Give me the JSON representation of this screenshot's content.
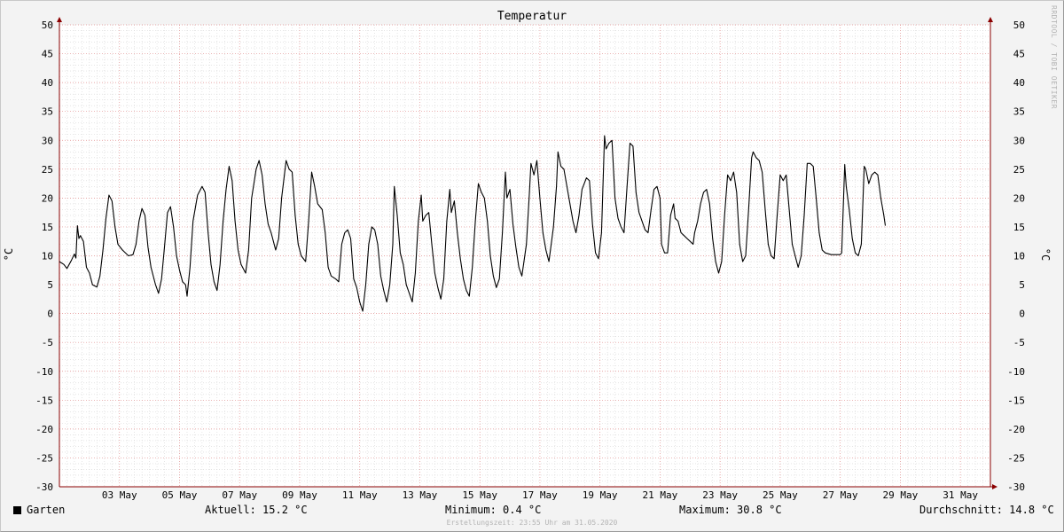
{
  "chart_data": {
    "type": "line",
    "title": "Temperatur",
    "ylabel": "°C",
    "ylim": [
      -30,
      50
    ],
    "yticks": [
      50,
      45,
      40,
      35,
      30,
      25,
      20,
      15,
      10,
      5,
      0,
      -5,
      -10,
      -15,
      -20,
      -25,
      -30
    ],
    "xlim_days": [
      1,
      32
    ],
    "xticks": [
      {
        "day": 3,
        "label": "03 May"
      },
      {
        "day": 5,
        "label": "05 May"
      },
      {
        "day": 7,
        "label": "07 May"
      },
      {
        "day": 9,
        "label": "09 May"
      },
      {
        "day": 11,
        "label": "11 May"
      },
      {
        "day": 13,
        "label": "13 May"
      },
      {
        "day": 15,
        "label": "15 May"
      },
      {
        "day": 17,
        "label": "17 May"
      },
      {
        "day": 19,
        "label": "19 May"
      },
      {
        "day": 21,
        "label": "21 May"
      },
      {
        "day": 23,
        "label": "23 May"
      },
      {
        "day": 25,
        "label": "25 May"
      },
      {
        "day": 27,
        "label": "27 May"
      },
      {
        "day": 29,
        "label": "29 May"
      },
      {
        "day": 31,
        "label": "31 May"
      }
    ],
    "grid": true,
    "series": [
      {
        "name": "Garten",
        "color": "#000000",
        "points": [
          [
            1.0,
            9.0
          ],
          [
            1.15,
            8.5
          ],
          [
            1.25,
            7.8
          ],
          [
            1.4,
            9.2
          ],
          [
            1.5,
            10.3
          ],
          [
            1.55,
            9.6
          ],
          [
            1.6,
            15.2
          ],
          [
            1.65,
            13.0
          ],
          [
            1.7,
            13.5
          ],
          [
            1.8,
            12.5
          ],
          [
            1.9,
            8.0
          ],
          [
            2.0,
            7.0
          ],
          [
            2.1,
            5.0
          ],
          [
            2.25,
            4.6
          ],
          [
            2.35,
            6.5
          ],
          [
            2.45,
            11.0
          ],
          [
            2.55,
            16.5
          ],
          [
            2.65,
            20.5
          ],
          [
            2.75,
            19.5
          ],
          [
            2.85,
            15.0
          ],
          [
            2.95,
            12.0
          ],
          [
            3.1,
            11.0
          ],
          [
            3.3,
            10.0
          ],
          [
            3.45,
            10.2
          ],
          [
            3.55,
            12.0
          ],
          [
            3.65,
            16.0
          ],
          [
            3.75,
            18.2
          ],
          [
            3.85,
            17.0
          ],
          [
            3.95,
            11.5
          ],
          [
            4.05,
            8.0
          ],
          [
            4.2,
            5.0
          ],
          [
            4.3,
            3.5
          ],
          [
            4.4,
            6.0
          ],
          [
            4.5,
            11.5
          ],
          [
            4.6,
            17.5
          ],
          [
            4.7,
            18.5
          ],
          [
            4.8,
            15.0
          ],
          [
            4.9,
            10.0
          ],
          [
            5.0,
            7.5
          ],
          [
            5.1,
            5.5
          ],
          [
            5.2,
            5.0
          ],
          [
            5.25,
            3.0
          ],
          [
            5.35,
            8.0
          ],
          [
            5.45,
            16.0
          ],
          [
            5.6,
            20.5
          ],
          [
            5.75,
            22.0
          ],
          [
            5.85,
            21.0
          ],
          [
            5.95,
            14.0
          ],
          [
            6.05,
            8.5
          ],
          [
            6.15,
            5.5
          ],
          [
            6.25,
            4.0
          ],
          [
            6.35,
            8.5
          ],
          [
            6.45,
            16.0
          ],
          [
            6.55,
            21.5
          ],
          [
            6.65,
            25.5
          ],
          [
            6.75,
            23.0
          ],
          [
            6.85,
            16.0
          ],
          [
            6.95,
            11.0
          ],
          [
            7.05,
            8.5
          ],
          [
            7.2,
            7.0
          ],
          [
            7.3,
            11.0
          ],
          [
            7.4,
            20.0
          ],
          [
            7.55,
            25.0
          ],
          [
            7.65,
            26.5
          ],
          [
            7.75,
            24.0
          ],
          [
            7.85,
            19.0
          ],
          [
            7.95,
            15.5
          ],
          [
            8.05,
            14.0
          ],
          [
            8.2,
            11.0
          ],
          [
            8.3,
            13.0
          ],
          [
            8.4,
            20.0
          ],
          [
            8.55,
            26.5
          ],
          [
            8.65,
            25.0
          ],
          [
            8.75,
            24.5
          ],
          [
            8.85,
            17.0
          ],
          [
            8.95,
            12.0
          ],
          [
            9.05,
            10.0
          ],
          [
            9.2,
            9.0
          ],
          [
            9.3,
            16.0
          ],
          [
            9.4,
            24.5
          ],
          [
            9.5,
            22.0
          ],
          [
            9.6,
            19.0
          ],
          [
            9.75,
            18.0
          ],
          [
            9.85,
            14.0
          ],
          [
            9.95,
            8.0
          ],
          [
            10.05,
            6.5
          ],
          [
            10.2,
            6.0
          ],
          [
            10.3,
            5.5
          ],
          [
            10.4,
            12.0
          ],
          [
            10.5,
            14.0
          ],
          [
            10.6,
            14.5
          ],
          [
            10.7,
            13.0
          ],
          [
            10.8,
            6.0
          ],
          [
            10.9,
            4.5
          ],
          [
            11.0,
            2.0
          ],
          [
            11.1,
            0.4
          ],
          [
            11.2,
            5.0
          ],
          [
            11.3,
            12.0
          ],
          [
            11.4,
            15.0
          ],
          [
            11.5,
            14.5
          ],
          [
            11.6,
            12.0
          ],
          [
            11.7,
            6.5
          ],
          [
            11.8,
            4.0
          ],
          [
            11.9,
            2.0
          ],
          [
            12.0,
            5.0
          ],
          [
            12.1,
            12.0
          ],
          [
            12.15,
            22.0
          ],
          [
            12.25,
            17.0
          ],
          [
            12.35,
            10.5
          ],
          [
            12.45,
            8.5
          ],
          [
            12.55,
            5.0
          ],
          [
            12.65,
            3.5
          ],
          [
            12.75,
            2.0
          ],
          [
            12.85,
            7.0
          ],
          [
            12.95,
            16.0
          ],
          [
            13.05,
            20.5
          ],
          [
            13.1,
            16.0
          ],
          [
            13.2,
            17.0
          ],
          [
            13.3,
            17.5
          ],
          [
            13.4,
            12.0
          ],
          [
            13.5,
            7.0
          ],
          [
            13.6,
            4.5
          ],
          [
            13.7,
            2.5
          ],
          [
            13.8,
            6.0
          ],
          [
            13.9,
            16.0
          ],
          [
            14.0,
            21.5
          ],
          [
            14.05,
            17.5
          ],
          [
            14.15,
            19.5
          ],
          [
            14.25,
            14.0
          ],
          [
            14.35,
            9.5
          ],
          [
            14.45,
            6.0
          ],
          [
            14.55,
            4.0
          ],
          [
            14.65,
            3.0
          ],
          [
            14.75,
            8.0
          ],
          [
            14.85,
            16.0
          ],
          [
            14.95,
            22.5
          ],
          [
            15.05,
            21.0
          ],
          [
            15.15,
            20.0
          ],
          [
            15.25,
            16.0
          ],
          [
            15.35,
            10.0
          ],
          [
            15.45,
            6.5
          ],
          [
            15.55,
            4.5
          ],
          [
            15.65,
            6.0
          ],
          [
            15.75,
            14.0
          ],
          [
            15.85,
            24.5
          ],
          [
            15.9,
            20.0
          ],
          [
            16.0,
            21.5
          ],
          [
            16.1,
            15.5
          ],
          [
            16.2,
            11.5
          ],
          [
            16.3,
            8.0
          ],
          [
            16.4,
            6.5
          ],
          [
            16.55,
            12.0
          ],
          [
            16.65,
            21.0
          ],
          [
            16.7,
            26.0
          ],
          [
            16.8,
            24.0
          ],
          [
            16.9,
            26.5
          ],
          [
            17.0,
            20.0
          ],
          [
            17.1,
            14.0
          ],
          [
            17.2,
            11.0
          ],
          [
            17.3,
            9.0
          ],
          [
            17.45,
            15.0
          ],
          [
            17.55,
            22.0
          ],
          [
            17.6,
            28.0
          ],
          [
            17.7,
            25.5
          ],
          [
            17.8,
            25.0
          ],
          [
            17.9,
            22.0
          ],
          [
            18.0,
            19.0
          ],
          [
            18.1,
            16.0
          ],
          [
            18.2,
            14.0
          ],
          [
            18.3,
            17.0
          ],
          [
            18.4,
            21.5
          ],
          [
            18.55,
            23.5
          ],
          [
            18.65,
            23.0
          ],
          [
            18.75,
            15.5
          ],
          [
            18.85,
            10.5
          ],
          [
            18.95,
            9.5
          ],
          [
            19.05,
            14.0
          ],
          [
            19.15,
            30.8
          ],
          [
            19.2,
            28.5
          ],
          [
            19.3,
            29.5
          ],
          [
            19.4,
            30.0
          ],
          [
            19.5,
            20.0
          ],
          [
            19.6,
            16.5
          ],
          [
            19.7,
            15.0
          ],
          [
            19.8,
            14.0
          ],
          [
            19.9,
            22.0
          ],
          [
            20.0,
            29.5
          ],
          [
            20.1,
            29.0
          ],
          [
            20.2,
            21.0
          ],
          [
            20.3,
            17.5
          ],
          [
            20.4,
            16.0
          ],
          [
            20.5,
            14.5
          ],
          [
            20.6,
            14.0
          ],
          [
            20.7,
            18.0
          ],
          [
            20.8,
            21.5
          ],
          [
            20.9,
            22.0
          ],
          [
            21.0,
            20.0
          ],
          [
            21.05,
            12.0
          ],
          [
            21.15,
            10.5
          ],
          [
            21.25,
            10.5
          ],
          [
            21.35,
            17.0
          ],
          [
            21.45,
            19.0
          ],
          [
            21.5,
            16.5
          ],
          [
            21.6,
            16.0
          ],
          [
            21.7,
            14.0
          ],
          [
            21.8,
            13.5
          ],
          [
            21.9,
            13.0
          ],
          [
            22.0,
            12.5
          ],
          [
            22.1,
            12.0
          ],
          [
            22.15,
            14.0
          ],
          [
            22.25,
            16.0
          ],
          [
            22.35,
            19.0
          ],
          [
            22.45,
            21.0
          ],
          [
            22.55,
            21.5
          ],
          [
            22.65,
            19.0
          ],
          [
            22.75,
            13.0
          ],
          [
            22.85,
            9.0
          ],
          [
            22.95,
            7.0
          ],
          [
            23.05,
            9.0
          ],
          [
            23.15,
            17.0
          ],
          [
            23.25,
            24.0
          ],
          [
            23.35,
            23.0
          ],
          [
            23.45,
            24.5
          ],
          [
            23.55,
            21.0
          ],
          [
            23.65,
            12.0
          ],
          [
            23.75,
            9.0
          ],
          [
            23.85,
            10.0
          ],
          [
            23.95,
            18.0
          ],
          [
            24.05,
            27.0
          ],
          [
            24.1,
            28.0
          ],
          [
            24.2,
            27.0
          ],
          [
            24.3,
            26.5
          ],
          [
            24.4,
            24.5
          ],
          [
            24.5,
            18.0
          ],
          [
            24.6,
            12.0
          ],
          [
            24.7,
            10.0
          ],
          [
            24.8,
            9.5
          ],
          [
            24.9,
            17.0
          ],
          [
            25.0,
            24.0
          ],
          [
            25.1,
            23.0
          ],
          [
            25.2,
            24.0
          ],
          [
            25.3,
            18.0
          ],
          [
            25.4,
            12.0
          ],
          [
            25.5,
            10.0
          ],
          [
            25.6,
            8.0
          ],
          [
            25.7,
            10.0
          ],
          [
            25.8,
            17.0
          ],
          [
            25.9,
            26.0
          ],
          [
            26.0,
            26.0
          ],
          [
            26.1,
            25.5
          ],
          [
            26.2,
            20.0
          ],
          [
            26.3,
            14.0
          ],
          [
            26.4,
            11.0
          ],
          [
            26.5,
            10.5
          ],
          [
            26.7,
            10.2
          ],
          [
            26.9,
            10.2
          ],
          [
            27.0,
            10.2
          ],
          [
            27.05,
            10.5
          ],
          [
            27.15,
            25.8
          ],
          [
            27.2,
            22.0
          ],
          [
            27.3,
            18.0
          ],
          [
            27.4,
            13.0
          ],
          [
            27.5,
            10.5
          ],
          [
            27.6,
            10.0
          ],
          [
            27.7,
            12.0
          ],
          [
            27.8,
            25.5
          ],
          [
            27.85,
            25.0
          ],
          [
            27.95,
            22.5
          ],
          [
            28.05,
            24.0
          ],
          [
            28.15,
            24.5
          ],
          [
            28.25,
            24.0
          ],
          [
            28.35,
            20.0
          ],
          [
            28.45,
            17.0
          ],
          [
            28.5,
            15.2
          ]
        ]
      }
    ]
  },
  "legend": {
    "label": "Garten",
    "color": "#000000"
  },
  "stats": {
    "current": "Aktuell: 15.2 °C",
    "minimum": "Minimum: 0.4 °C",
    "maximum": "Maximum: 30.8 °C",
    "average": "Durchschnitt: 14.8 °C"
  },
  "watermark": "RRDTOOL / TOBI OETIKER",
  "footer": "Erstellungszeit: 23:55 Uhr am 31.05.2020",
  "colors": {
    "background": "#f3f3f3",
    "plot_background": "#ffffff",
    "minor_grid": "#d6d6d6",
    "major_grid": "#e08c8c",
    "axis": "#8b0000"
  }
}
